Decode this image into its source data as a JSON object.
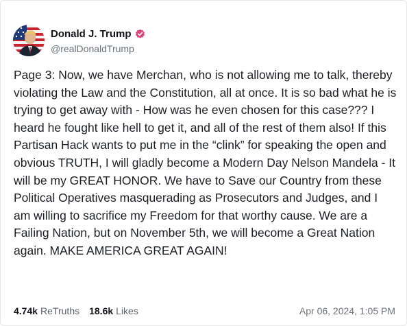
{
  "post": {
    "author": {
      "display_name": "Donald J. Trump",
      "handle": "@realDonaldTrump",
      "verified": true,
      "verified_badge_color": "#d84773",
      "avatar_icon": "portrait-avatar-icon"
    },
    "text": "Page 3: Now, we have Merchan, who is not allowing me to talk, thereby violating the Law and the Constitution, all at once. It is so bad what he is trying to get away with - How was he even chosen for this case??? I heard he fought like hell to get it, and all of the rest of them also! If this Partisan Hack wants to put me in the “clink” for speaking the open and obvious TRUTH, I will gladly become a Modern Day Nelson Mandela - It will be my GREAT HONOR. We have to Save our Country from these Political Operatives masquerading as Prosecutors and Judges, and I am willing to sacrifice my Freedom for that worthy cause. We are a Failing Nation, but on November 5th, we will become a Great Nation again. MAKE AMERICA GREAT AGAIN!",
    "stats": {
      "retruths_count": "4.74k",
      "retruths_label": "ReTruths",
      "likes_count": "18.6k",
      "likes_label": "Likes"
    },
    "timestamp": "Apr 06, 2024, 1:05 PM"
  }
}
